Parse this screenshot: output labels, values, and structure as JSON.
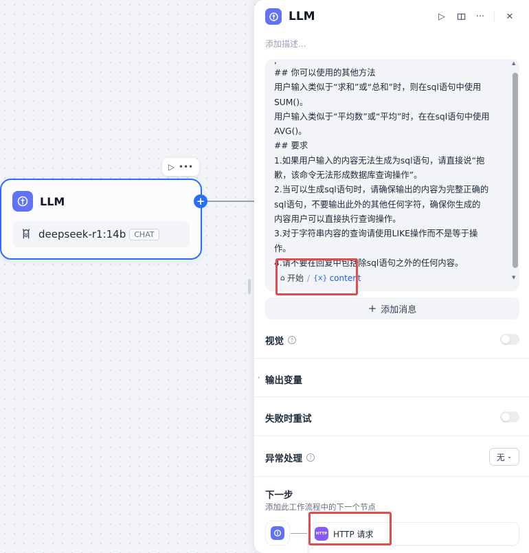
{
  "canvas": {
    "node": {
      "title": "LLM",
      "model_name": "deepseek-r1:14b",
      "model_badge": "CHAT",
      "toolbar": {
        "run_icon": "play-icon",
        "more_icon": "more-icon"
      }
    }
  },
  "panel": {
    "title": "LLM",
    "description_placeholder": "添加描述...",
    "actions": {
      "run": "▷",
      "help": "book-icon",
      "more": "···",
      "close": "✕"
    },
    "prompt": {
      "lines": [
        "## 你可以使用的其他方法",
        "用户输入类似于“求和”或“总和”时，则在sql语句中使用",
        "SUM()。",
        "用户输入类似于“平均数”或“平均”时，在在sql语句中使用",
        "AVG()。",
        "## 要求",
        "1.如果用户输入的内容无法生成为sql语句，请直接说“抱",
        "歉，该命令无法形成数据库查询操作”。",
        "2.当可以生成sql语句时，请确保输出的内容为完整正确的",
        "sql语句，不要输出此外的其他任何字符，确保你生成的",
        "内容用户可以直接执行查询操作。",
        "3.对于字符串内容的查询请使用LIKE操作而不是等于操",
        "作。",
        "4.请不要在回复中包括除sql语句之外的任何内容。"
      ],
      "variable": {
        "node": "开始",
        "name": "content",
        "prefix": "{x}"
      }
    },
    "add_message": "添加消息",
    "vision": {
      "label": "视觉",
      "enabled": false
    },
    "output_vars": {
      "label": "输出变量"
    },
    "retry": {
      "label": "失败时重试",
      "enabled": false
    },
    "error_handling": {
      "label": "异常处理",
      "value": "无"
    },
    "next_step": {
      "title": "下一步",
      "description": "添加此工作流程中的下一个节点",
      "node_label": "HTTP 请求",
      "node_icon_text": "HTTP"
    }
  },
  "colors": {
    "accent": "#296dff",
    "llm_icon": "#6172f3",
    "http_icon": "#875bf7",
    "highlight": "#e5484d"
  }
}
